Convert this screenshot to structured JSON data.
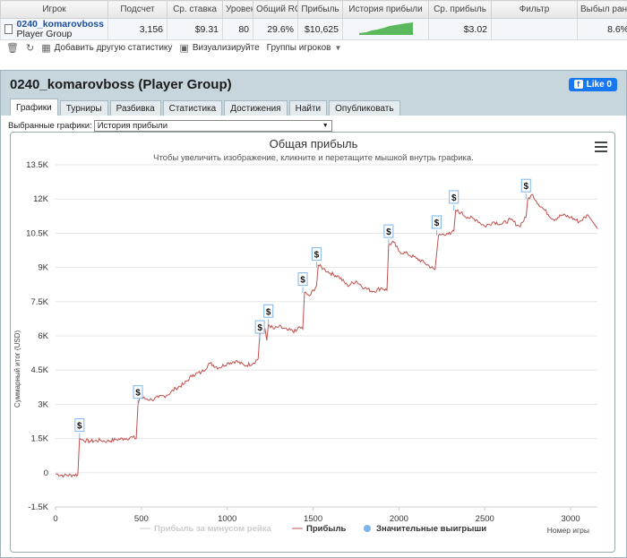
{
  "table": {
    "headers": [
      "Игрок",
      "Подсчет",
      "Ср. ставка",
      "Уровень",
      "Общий ROI",
      "Прибыль",
      "История прибыли",
      "Ср. прибыль",
      "Фильтр",
      "Выбыл ранее"
    ],
    "row": {
      "player_name": "0240_komarovboss",
      "player_group": "Player Group",
      "count": "3,156",
      "avg_stake": "$9.31",
      "level": "80",
      "roi": "29.6%",
      "profit": "$10,625",
      "avg_profit": "$3.02",
      "filter": "",
      "early_out": "8.6%"
    }
  },
  "toolbar": {
    "add_stats": "Добавить другую статистику",
    "visualize": "Визуализируйте",
    "groups": "Группы игроков"
  },
  "panel": {
    "title": "0240_komarovboss (Player Group)",
    "like": "Like 0",
    "tabs": [
      "Графики",
      "Турниры",
      "Разбивка",
      "Статистика",
      "Достижения",
      "Найти",
      "Опубликовать"
    ],
    "selector_label": "Выбранные графики:",
    "selector_value": "История прибыли"
  },
  "chart_data": {
    "type": "line",
    "title": "Общая прибыль",
    "subtitle": "Чтобы увеличить изображение, кликните и перетащите мышкой внутрь графика.",
    "xlabel": "Номер игры",
    "ylabel": "Суммарный итог (USD)",
    "xlim": [
      0,
      3156
    ],
    "ylim": [
      -1500,
      13500
    ],
    "xticks": [
      "0",
      "500",
      "1000",
      "1500",
      "2000",
      "2500",
      "3000"
    ],
    "xtick_values": [
      0,
      500,
      1000,
      1500,
      2000,
      2500,
      3000
    ],
    "yticks": [
      "-1.5K",
      "0",
      "1.5K",
      "3K",
      "4.5K",
      "6K",
      "7.5K",
      "9K",
      "10.5K",
      "12K",
      "13.5K"
    ],
    "ytick_values": [
      -1500,
      0,
      1500,
      3000,
      4500,
      6000,
      7500,
      9000,
      10500,
      12000,
      13500
    ],
    "grid": true,
    "legend_position": "bottom",
    "legend": [
      "Прибыль за минусом рейка",
      "Прибыль",
      "Значительные выигрыши"
    ],
    "colors": {
      "profit": "#c0504d",
      "rake": "#cccccc",
      "bigwin": "#7cb5ec"
    },
    "series": [
      {
        "name": "Прибыль",
        "x": [
          0,
          50,
          100,
          130,
          140,
          150,
          200,
          260,
          300,
          350,
          400,
          450,
          470,
          480,
          490,
          520,
          560,
          600,
          650,
          700,
          750,
          800,
          850,
          900,
          950,
          1000,
          1050,
          1100,
          1150,
          1180,
          1190,
          1220,
          1230,
          1240,
          1270,
          1300,
          1350,
          1400,
          1420,
          1440,
          1450,
          1470,
          1480,
          1520,
          1530,
          1560,
          1600,
          1650,
          1700,
          1750,
          1800,
          1850,
          1900,
          1930,
          1940,
          1970,
          2000,
          2050,
          2100,
          2150,
          2200,
          2210,
          2230,
          2280,
          2300,
          2320,
          2330,
          2360,
          2400,
          2450,
          2500,
          2550,
          2600,
          2650,
          2700,
          2740,
          2750,
          2780,
          2800,
          2850,
          2900,
          2950,
          3000,
          3050,
          3100,
          3156
        ],
        "y": [
          -50,
          -120,
          -100,
          -80,
          1500,
          1450,
          1380,
          1420,
          1380,
          1450,
          1500,
          1550,
          1500,
          2950,
          3300,
          3250,
          3200,
          3300,
          3400,
          3700,
          3900,
          4300,
          4400,
          4800,
          4600,
          4800,
          4900,
          4700,
          4800,
          5000,
          6100,
          6300,
          5800,
          6500,
          6300,
          6400,
          6250,
          6200,
          6400,
          6300,
          7900,
          7800,
          7750,
          8200,
          9100,
          8950,
          8750,
          8600,
          8200,
          8400,
          8100,
          7950,
          8100,
          8000,
          10000,
          10100,
          9700,
          9600,
          9400,
          9200,
          8950,
          8900,
          10400,
          10500,
          10450,
          10600,
          11500,
          11400,
          11200,
          11100,
          10800,
          11000,
          10900,
          11100,
          10800,
          11200,
          12000,
          12200,
          11900,
          11500,
          11100,
          11300,
          11200,
          11000,
          11300,
          10700
        ]
      }
    ],
    "big_wins_x": [
      140,
      480,
      1190,
      1240,
      1440,
      1520,
      1940,
      2220,
      2320,
      2740
    ],
    "big_wins_y": [
      1500,
      2950,
      5800,
      6500,
      7900,
      9000,
      10000,
      10400,
      11500,
      12000
    ],
    "big_win_label": "$"
  }
}
